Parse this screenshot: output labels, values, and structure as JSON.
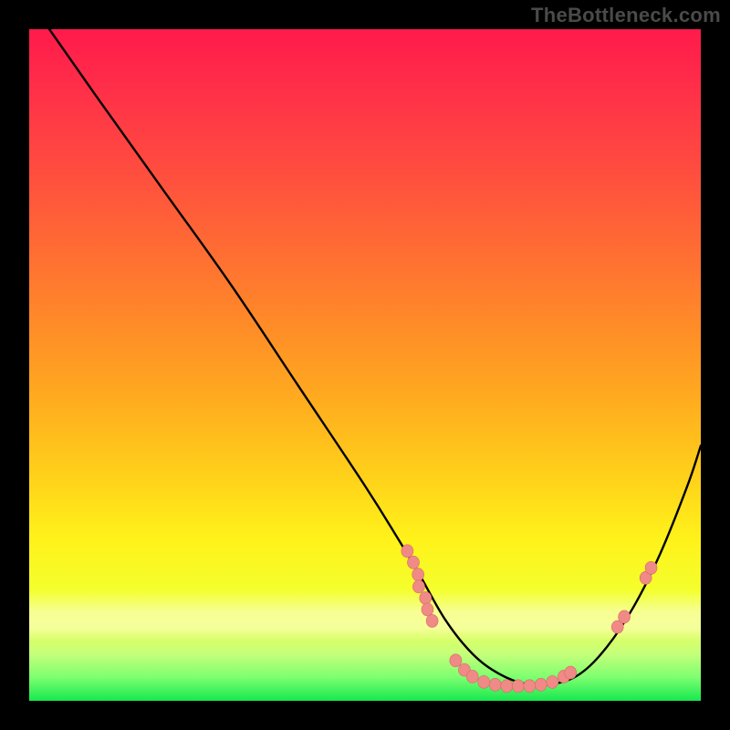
{
  "watermark": "TheBottleneck.com",
  "colors": {
    "background": "#000000",
    "curve": "#000000",
    "marker_fill": "#f08a86",
    "marker_stroke": "#d86a64",
    "gradient_top": "#ff1a4b",
    "gradient_bottom": "#17e84f"
  },
  "chart_data": {
    "type": "line",
    "title": "",
    "xlabel": "",
    "ylabel": "",
    "xlim": [
      0,
      100
    ],
    "ylim": [
      0,
      100
    ],
    "grid": false,
    "legend": false,
    "series": [
      {
        "name": "bottleneck-curve",
        "x": [
          3,
          10,
          20,
          30,
          40,
          50,
          55,
          58,
          62,
          66,
          70,
          74,
          78,
          82,
          86,
          90,
          94,
          98,
          100
        ],
        "y": [
          100,
          90,
          76,
          62,
          47,
          32,
          24,
          19,
          12,
          7,
          4,
          2.5,
          2.5,
          4,
          8,
          14,
          22,
          32,
          38
        ]
      }
    ],
    "markers": [
      {
        "x": 56.3,
        "y": 22.3
      },
      {
        "x": 57.2,
        "y": 20.6
      },
      {
        "x": 57.9,
        "y": 18.8
      },
      {
        "x": 58.0,
        "y": 17.0
      },
      {
        "x": 59.0,
        "y": 15.3
      },
      {
        "x": 59.3,
        "y": 13.6
      },
      {
        "x": 60.0,
        "y": 11.9
      },
      {
        "x": 63.5,
        "y": 6.0
      },
      {
        "x": 64.8,
        "y": 4.6
      },
      {
        "x": 66.0,
        "y": 3.6
      },
      {
        "x": 67.7,
        "y": 2.8
      },
      {
        "x": 69.4,
        "y": 2.4
      },
      {
        "x": 71.1,
        "y": 2.2
      },
      {
        "x": 72.8,
        "y": 2.2
      },
      {
        "x": 74.5,
        "y": 2.2
      },
      {
        "x": 76.2,
        "y": 2.4
      },
      {
        "x": 77.9,
        "y": 2.8
      },
      {
        "x": 79.6,
        "y": 3.6
      },
      {
        "x": 80.6,
        "y": 4.2
      },
      {
        "x": 87.6,
        "y": 11.0
      },
      {
        "x": 88.6,
        "y": 12.5
      },
      {
        "x": 91.8,
        "y": 18.3
      },
      {
        "x": 92.6,
        "y": 19.8
      }
    ],
    "marker_radius": 6.5
  }
}
